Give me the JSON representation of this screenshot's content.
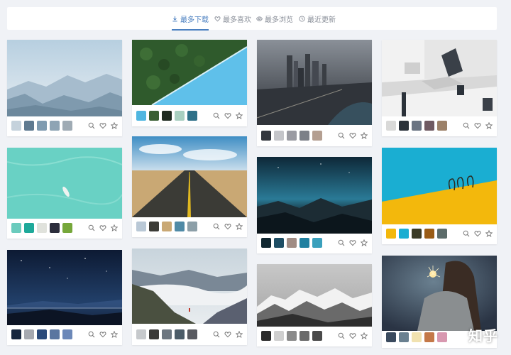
{
  "tabs": [
    {
      "label": "最多下载",
      "icon": "download-icon",
      "active": true
    },
    {
      "label": "最多喜欢",
      "icon": "heart-icon",
      "active": false
    },
    {
      "label": "最多浏览",
      "icon": "eye-icon",
      "active": false
    },
    {
      "label": "最近更新",
      "icon": "clock-icon",
      "active": false
    }
  ],
  "cards": [
    {
      "id": "misty-mountains",
      "swatches": [
        "#c5d2dc",
        "#5f7a90",
        "#7f9bb0",
        "#8ea4b4",
        "#9fabb4"
      ]
    },
    {
      "id": "forest-water-aerial",
      "swatches": [
        "#4fb6e0",
        "#3a5f34",
        "#1e2a20",
        "#a8cfc0",
        "#2e7088"
      ]
    },
    {
      "id": "city-skyline",
      "swatches": [
        "#33373d",
        "#c4c5c9",
        "#9a9ba2",
        "#7c8088",
        "#b49f91"
      ]
    },
    {
      "id": "desk-laptop",
      "swatches": [
        "#d9d9d8",
        "#2b323a",
        "#6a7482",
        "#6f5a62",
        "#9c8169"
      ]
    },
    {
      "id": "turquoise-sea-boat",
      "swatches": [
        "#6bcbbd",
        "#1ea99a",
        "#e0e2dc",
        "#2c2e3c",
        "#76a73a"
      ]
    },
    {
      "id": "desert-road",
      "swatches": [
        "#b9c8d6",
        "#3b3b36",
        "#c9a874",
        "#4f8aa6",
        "#8c9fa8"
      ]
    },
    {
      "id": "night-valley",
      "swatches": [
        "#0f2630",
        "#1e4e64",
        "#a08c84",
        "#2080a0",
        "#3aa0bc"
      ]
    },
    {
      "id": "yellow-wall",
      "swatches": [
        "#f3b80c",
        "#1aaed2",
        "#3a3a24",
        "#9a5c16",
        "#5c6c6a"
      ]
    },
    {
      "id": "starry-lake",
      "swatches": [
        "#16263e",
        "#a6a9b0",
        "#2a4a7a",
        "#5a76a0",
        "#6c88b8"
      ]
    },
    {
      "id": "cloud-mountains",
      "swatches": [
        "#c6c9cc",
        "#3a3a38",
        "#6c7680",
        "#4c5c68",
        "#585a60"
      ]
    },
    {
      "id": "snowy-peaks",
      "swatches": [
        "#2b2b2b",
        "#cfcfcf",
        "#8a8a8a",
        "#6a6a6a",
        "#4a4a4a"
      ]
    },
    {
      "id": "sparkler-girl",
      "swatches": [
        "#3a4a5e",
        "#6a8090",
        "#f1e2b0",
        "#c47848",
        "#d898b0"
      ]
    }
  ],
  "watermark": "知乎"
}
